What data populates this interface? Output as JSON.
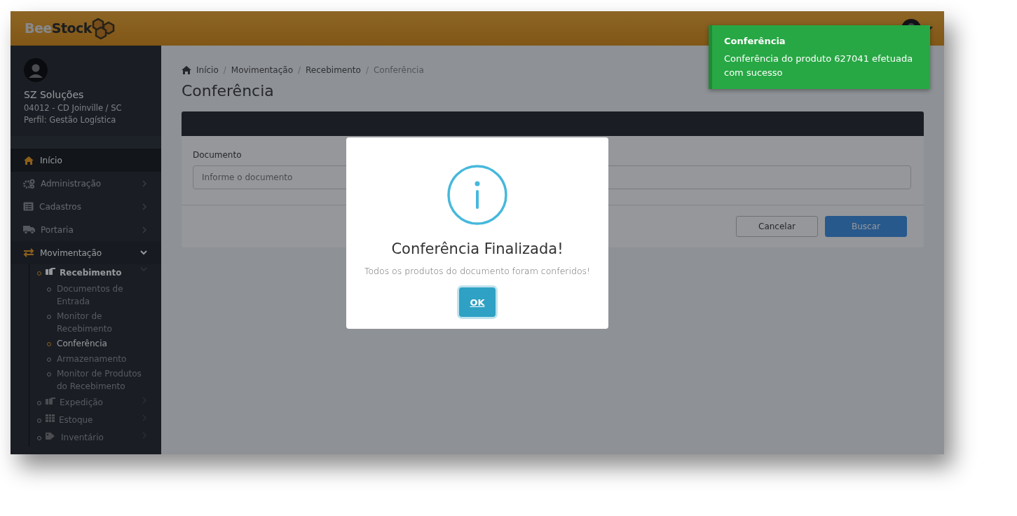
{
  "header": {
    "logo": {
      "part1": "Bee",
      "part2": "Stock"
    }
  },
  "profile": {
    "company": "SZ Soluções",
    "unit": "04012 - CD Joinville / SC",
    "role": "Perfil: Gestão Logística"
  },
  "sidebar": {
    "items": [
      {
        "label": "Início",
        "selected": true,
        "expanded": false,
        "has_children": false
      },
      {
        "label": "Administração",
        "selected": false,
        "expanded": false,
        "has_children": true
      },
      {
        "label": "Cadastros",
        "selected": false,
        "expanded": false,
        "has_children": true
      },
      {
        "label": "Portaria",
        "selected": false,
        "expanded": false,
        "has_children": true
      },
      {
        "label": "Movimentação",
        "expanded": true,
        "has_children": true,
        "children": [
          {
            "label": "Recebimento",
            "expanded": true,
            "has_children": true,
            "children": [
              {
                "label": "Documentos de Entrada",
                "selected": false
              },
              {
                "label": "Monitor de Recebimento",
                "selected": false
              },
              {
                "label": "Conferência",
                "selected": true
              },
              {
                "label": "Armazenamento",
                "selected": false
              },
              {
                "label": "Monitor de Produtos do Recebimento",
                "selected": false
              }
            ]
          },
          {
            "label": "Expedição",
            "selected": false,
            "expanded": false,
            "has_children": true
          },
          {
            "label": "Estoque",
            "selected": false,
            "expanded": false,
            "has_children": true
          },
          {
            "label": "Inventário",
            "selected": false,
            "expanded": false,
            "has_children": true
          }
        ]
      }
    ]
  },
  "breadcrumb_separator": "/",
  "breadcrumb": [
    {
      "label": "Início",
      "active": false
    },
    {
      "label": "Movimentação",
      "active": false
    },
    {
      "label": "Recebimento",
      "active": false
    },
    {
      "label": "Conferência",
      "active": true
    }
  ],
  "page_title": "Conferência",
  "form": {
    "label": "Documento",
    "placeholder": "Informe o documento",
    "buttons": [
      {
        "label": "Cancelar",
        "kind": "secondary"
      },
      {
        "label": "Buscar",
        "kind": "primary"
      }
    ]
  },
  "modal": {
    "title": "Conferência Finalizada!",
    "message": "Todos os produtos do documento foram conferidos!",
    "button": "OK"
  },
  "toast": {
    "title": "Conferência",
    "message": "Conferência do produto 627041 efetuada com sucesso"
  }
}
